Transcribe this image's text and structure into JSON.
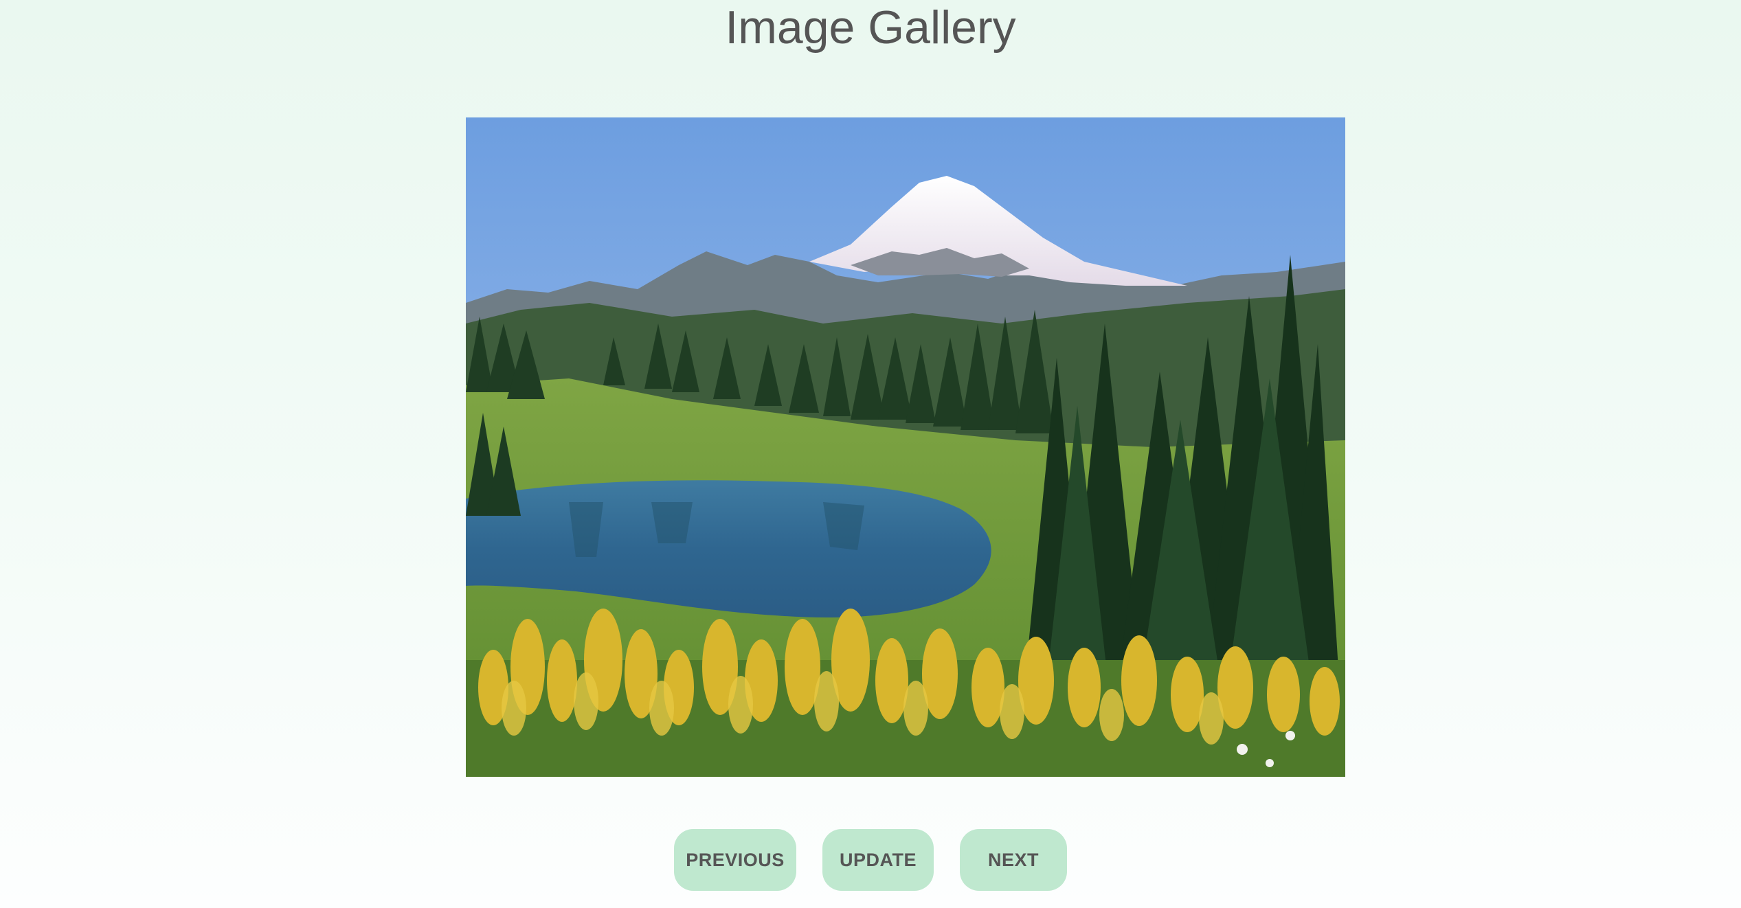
{
  "page": {
    "title": "Image Gallery"
  },
  "gallery": {
    "current_image": "mountain-lake-landscape"
  },
  "controls": {
    "previous_label": "PREVIOUS",
    "update_label": "UPDATE",
    "next_label": "NEXT"
  },
  "colors": {
    "background_top": "#eaf8f0",
    "background_bottom": "#fdfefe",
    "button_bg": "#bfe8cf",
    "text": "#555555"
  }
}
